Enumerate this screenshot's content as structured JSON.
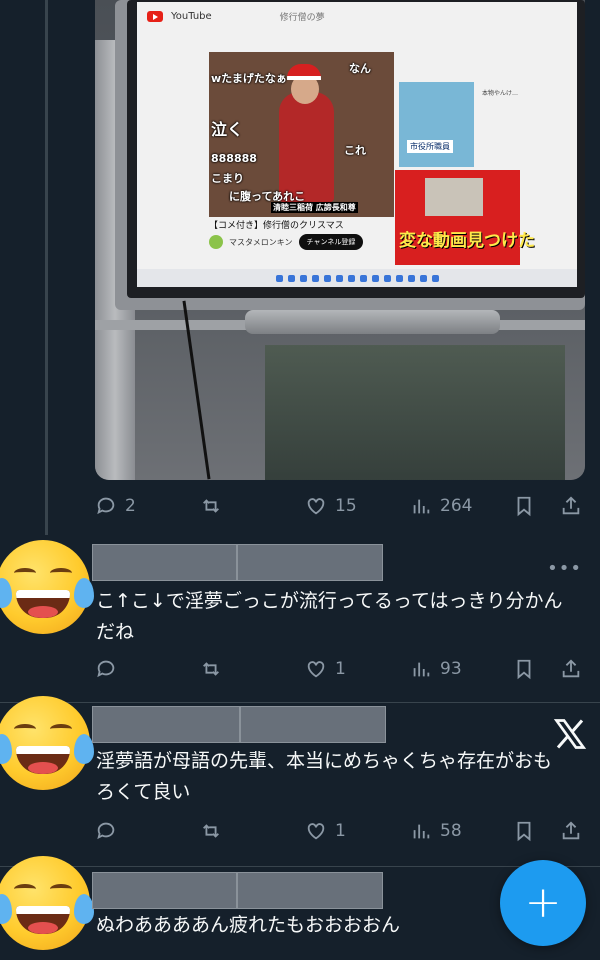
{
  "media": {
    "yt_brand": "YouTube",
    "yt_search": "修行僧の夢",
    "video_title": "【コメ付き】修行僧のクリスマス",
    "channel_name": "マスタメロンキン",
    "subscribe_label": "チャンネル登録",
    "caption": "清睦三稲荷 広諦長和尊",
    "comments": [
      "なん",
      "wたまげたなぁ",
      "泣く",
      "888888",
      "こまり",
      "に腹ってあれこ",
      "これ"
    ],
    "side_tag": "市役所職員",
    "side_banner": "変な動画見つけた",
    "side_label": "本物やんけ…"
  },
  "post": {
    "reply_count": "2",
    "like_count": "15",
    "view_count": "264"
  },
  "replies": [
    {
      "text": "こ↑こ↓で淫夢ごっこが流行ってるってはっきり分かんだね",
      "reply_count": "",
      "like_count": "1",
      "view_count": "93"
    },
    {
      "text": "淫夢語が母語の先輩、本当にめちゃくちゃ存在がおもろくて良い",
      "reply_count": "",
      "like_count": "1",
      "view_count": "58"
    },
    {
      "text": "ぬわああああん疲れたもおおおおん"
    }
  ],
  "icons": {
    "more": "more-icon",
    "compose": "plus-icon",
    "brand": "x-logo-icon"
  },
  "colors": {
    "background": "#15202b",
    "accent": "#1d9bf0",
    "muted": "#8b98a5"
  }
}
